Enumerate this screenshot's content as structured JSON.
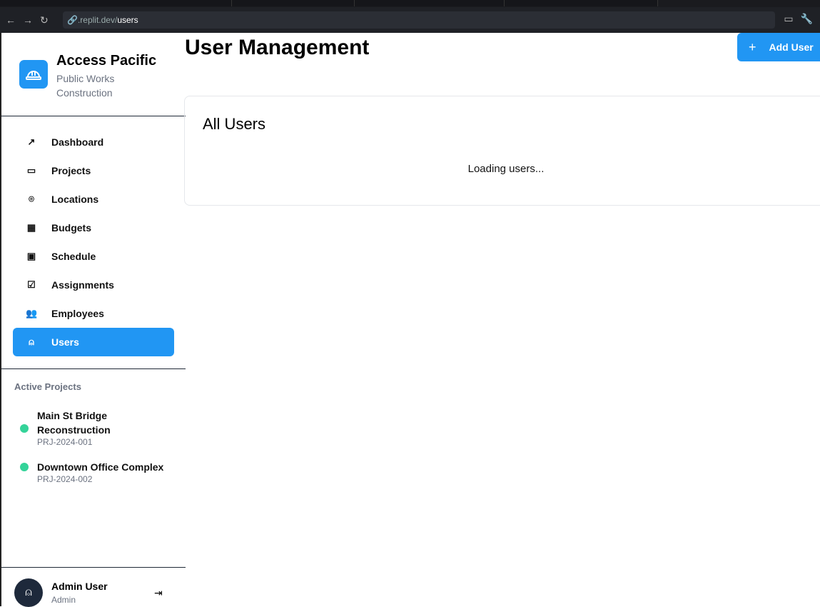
{
  "browser": {
    "url_prefix": ".replit.dev/",
    "url_path": "users"
  },
  "sidebar": {
    "brand": "Access Pacific",
    "subtitle": "Public Works Construction",
    "items": [
      {
        "label": "Dashboard",
        "icon": "chart-line-icon",
        "glyph": "↗"
      },
      {
        "label": "Projects",
        "icon": "folder-icon",
        "glyph": "▭"
      },
      {
        "label": "Locations",
        "icon": "map-pin-icon",
        "glyph": "⌾"
      },
      {
        "label": "Budgets",
        "icon": "calculator-icon",
        "glyph": "▦"
      },
      {
        "label": "Schedule",
        "icon": "calendar-icon",
        "glyph": "▣"
      },
      {
        "label": "Assignments",
        "icon": "check-square-icon",
        "glyph": "☑"
      },
      {
        "label": "Employees",
        "icon": "users-icon",
        "glyph": "👥"
      },
      {
        "label": "Users",
        "icon": "user-icon",
        "glyph": "⍝"
      }
    ],
    "active": "Users",
    "active_projects_label": "Active Projects",
    "projects": [
      {
        "name": "Main St Bridge Reconstruction",
        "code": "PRJ-2024-001"
      },
      {
        "name": "Downtown Office Complex",
        "code": "PRJ-2024-002"
      }
    ],
    "user": {
      "name": "Admin User",
      "role": "Admin"
    }
  },
  "main": {
    "title": "User Management",
    "add_button": "Add User",
    "card_title": "All Users",
    "loading": "Loading users..."
  },
  "colors": {
    "accent": "#2196f3",
    "status": "#34d399"
  }
}
